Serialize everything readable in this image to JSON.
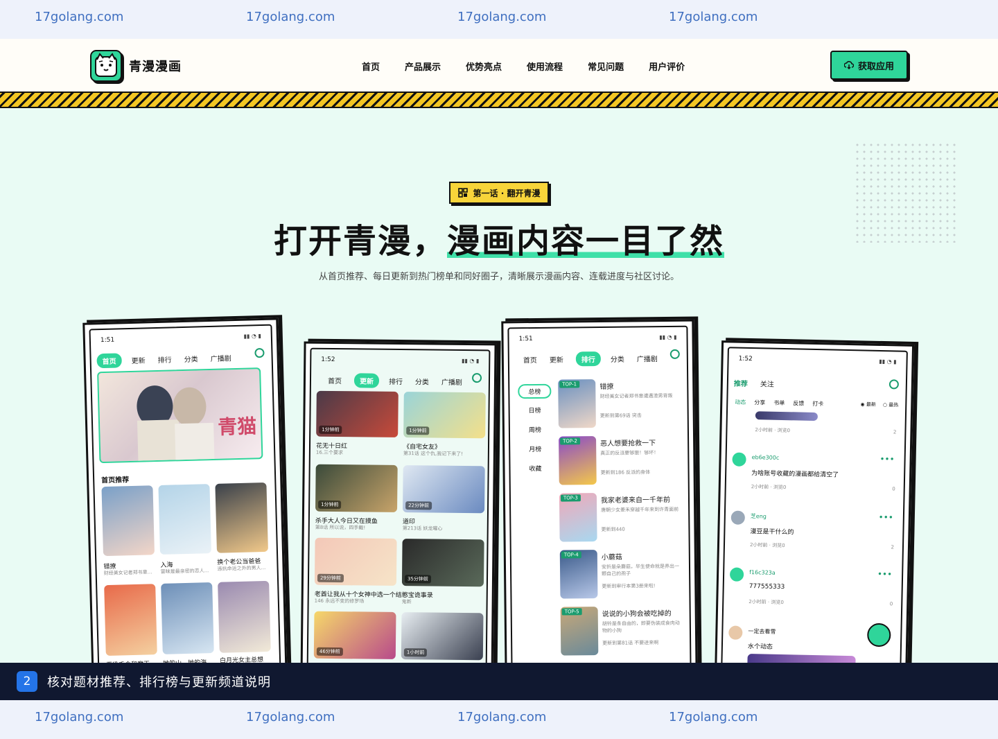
{
  "watermark": {
    "text": "17golang.com"
  },
  "nav": {
    "brand": "青漫漫画",
    "menu": [
      "首页",
      "产品展示",
      "优势亮点",
      "使用流程",
      "常见问题",
      "用户评价"
    ],
    "cta_label": "获取应用"
  },
  "hero": {
    "tag": "第一话 · 翻开青漫",
    "title_plain": "打开青漫，",
    "title_highlight": "漫画内容一目了然",
    "subtitle": "从首页推荐、每日更新到热门榜单和同好圈子，清晰展示漫画内容、连载进度与社区讨论。"
  },
  "phone1": {
    "time": "1:51",
    "tabs": [
      "首页",
      "更新",
      "排行",
      "分类",
      "广播剧"
    ],
    "banner_text": "青猫",
    "section": "首页推荐",
    "items": [
      {
        "title": "错撩",
        "desc": "财经美女记者郑书意..."
      },
      {
        "title": "入海",
        "desc": "冒昧是最亲密的恋人..."
      },
      {
        "title": "换个老公当爸爸",
        "desc": "违抗命运之外的男人..."
      },
      {
        "title": "恶役千金和魔王",
        "desc": ""
      },
      {
        "title": "她的山，她的海",
        "desc": ""
      },
      {
        "title": "白月光女主总想",
        "desc": ""
      }
    ]
  },
  "phone2": {
    "time": "1:52",
    "tabs": [
      "首页",
      "更新",
      "排行",
      "分类",
      "广播剧"
    ],
    "items": [
      {
        "title": "花无十日红",
        "desc": "16.三个要求",
        "time": "1分钟前"
      },
      {
        "title": "《自宅女友》",
        "desc": "第31话 这个仇,我记下来了!",
        "time": "1分钟前"
      },
      {
        "title": "杀手大人今日又在摸鱼",
        "desc": "第8话 所以说，四手戴!",
        "time": "1分钟前"
      },
      {
        "title": "道印",
        "desc": "第213话 妖龙曜心",
        "time": "22分钟前"
      },
      {
        "title": "老酋让我从十个女神中选一个结",
        "desc": "146 永远不变的修罗场",
        "time": "29分钟前"
      },
      {
        "title": "憨宝诡事录",
        "desc": "鬼新",
        "time": "35分钟前"
      },
      {
        "title": "",
        "desc": "",
        "time": "46分钟前"
      },
      {
        "title": "",
        "desc": "",
        "time": "1小时前"
      }
    ]
  },
  "phone3": {
    "time": "1:51",
    "tabs": [
      "首页",
      "更新",
      "排行",
      "分类",
      "广播剧"
    ],
    "side": [
      "总榜",
      "日榜",
      "周榜",
      "月榜",
      "收藏"
    ],
    "items": [
      {
        "rank": "TOP-1",
        "title": "错撩",
        "desc": "财经美女记者郑书意遭遇渣男背叛",
        "update": "更新到第69话 突击"
      },
      {
        "rank": "TOP-2",
        "title": "恶人想要抢救一下",
        "desc": "真正的反派要够狠！够坏！",
        "update": "更新到186 反派的身体"
      },
      {
        "rank": "TOP-3",
        "title": "我家老婆来自一千年前",
        "desc": "唐朝少女姜禾穿越千年来到许青面前",
        "update": "更新到440"
      },
      {
        "rank": "TOP-4",
        "title": "小蘑菇",
        "desc": "安折是朵蘑菇，毕生使命就是养出一颗自己的孢子",
        "update": "更新到审行本第3册来啦!"
      },
      {
        "rank": "TOP-5",
        "title": "说说的小狗会被吃掉的",
        "desc": "胡铃是条自由的，即要伪装成食肉动物的小狗",
        "update": "更新到第81话 不要进来啊"
      }
    ]
  },
  "phone4": {
    "time": "1:52",
    "tabs": [
      "推荐",
      "关注"
    ],
    "subtabs": [
      "动态",
      "分享",
      "书单",
      "反馈",
      "打卡"
    ],
    "sort": [
      "最新",
      "最热"
    ],
    "posts": [
      {
        "user": "",
        "text": "",
        "meta": "2小时前 · 浏览0",
        "likes": "2"
      },
      {
        "user": "eb6e300c",
        "text": "为啥账号收藏的漫画都给清空了",
        "meta": "2小时前 · 浏览0",
        "likes": "0"
      },
      {
        "user": "芝eng",
        "text": "漫豆是干什么的",
        "meta": "2小时前 · 浏览0",
        "likes": "2"
      },
      {
        "user": "f16c323a",
        "text": "777555333",
        "meta": "2小时前 · 浏览0",
        "likes": "0"
      },
      {
        "user": "一定去看雪",
        "text": "水个动态",
        "meta": "",
        "likes": ""
      }
    ]
  },
  "caption": {
    "num": "2",
    "text": "核对题材推荐、排行榜与更新频道说明"
  },
  "colors": {
    "accent": "#2fd59a",
    "yellow": "#f8d43a",
    "dark": "#101830"
  }
}
